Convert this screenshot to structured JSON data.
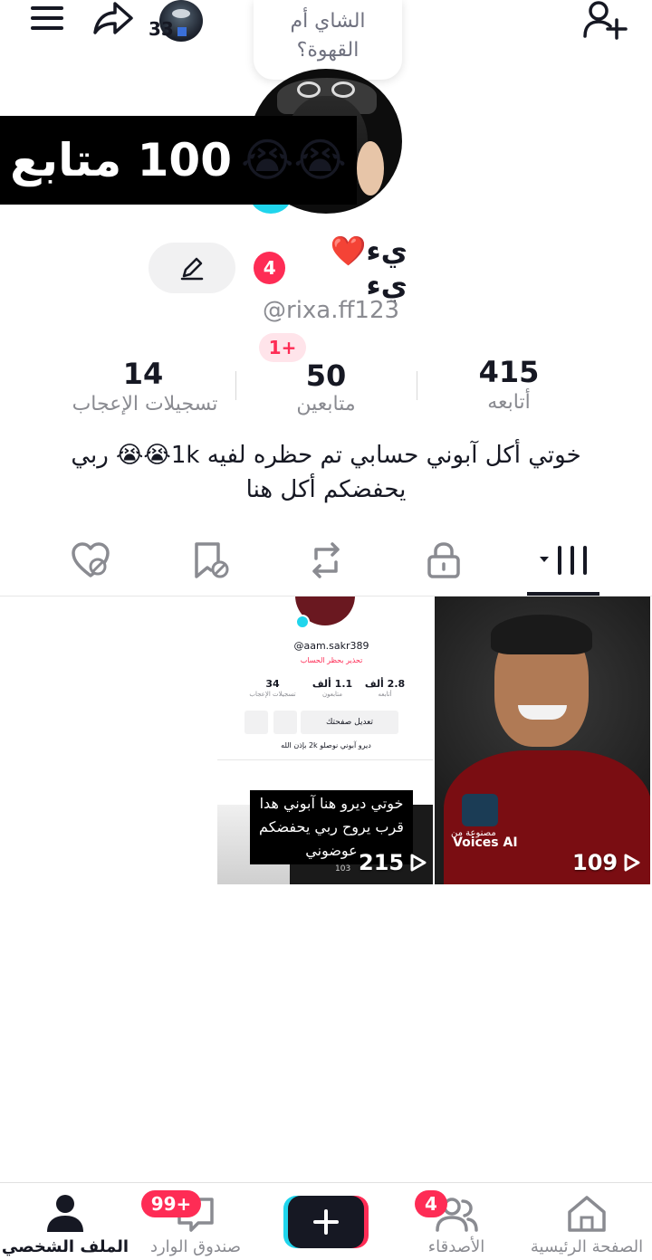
{
  "header": {
    "menu_icon": "hamburger-icon",
    "share_icon": "share-arrow-icon",
    "mini_avatar_count": "33",
    "bubble_text_line1": "الشاي أم",
    "bubble_text_line2": "القهوة؟",
    "add_friend_icon": "person-plus-icon"
  },
  "banner": {
    "text": "100 متابع",
    "emoji": "😭😭"
  },
  "profile": {
    "display_name": "يء❤️يء",
    "name_badge": "4",
    "username": "@rixa.ff123",
    "edit_icon": "pencil-icon"
  },
  "stats": {
    "new_badge": "1+",
    "following_value": "415",
    "following_label": "أتابعه",
    "followers_value": "50",
    "followers_label": "متابعين",
    "likes_value": "14",
    "likes_label": "تسجيلات الإعجاب"
  },
  "bio": {
    "line1": "خوتي أكل آبوني حسابي تم حظره لفيه 1k😭😭 ربي",
    "line2": "يحفضكم أكل هنا"
  },
  "tabs": [
    {
      "name": "videos",
      "icon": "grid-bars-icon"
    },
    {
      "name": "private",
      "icon": "lock-icon"
    },
    {
      "name": "reposts",
      "icon": "repost-icon"
    },
    {
      "name": "favorites",
      "icon": "bookmark-hidden-icon"
    },
    {
      "name": "liked",
      "icon": "heart-hidden-icon"
    }
  ],
  "videos": [
    {
      "views": "109",
      "watermark": "Voices AI",
      "watermark_small": "مصنوعة من"
    },
    {
      "views": "215",
      "caption_line1": "خوتي ديرو هنا آبوني هدا",
      "caption_line2": "قرب يروح ربي يحفضكم",
      "caption_line3": "عوضوني",
      "inner": {
        "username": "@aam.sakr389",
        "warning": "تحذير بحظر الحساب",
        "s1_val": "2.8 ألف",
        "s1_lab": "أتابعه",
        "s2_val": "1.1 ألف",
        "s2_lab": "متابعون",
        "s3_val": "34",
        "s3_lab": "تسجيلات الإعجاب",
        "edit": "تعديل صفحتك",
        "bio": "ديرو آبوني نوصلو 2k بإذن الله",
        "count": "103"
      }
    }
  ],
  "nav": {
    "home_label": "الصفحة الرئيسية",
    "friends_label": "الأصدقاء",
    "friends_badge": "4",
    "inbox_label": "صندوق الوارد",
    "inbox_badge": "99+",
    "profile_label": "الملف الشخصي"
  },
  "colors": {
    "accent": "#fe2c55",
    "cyan": "#20d5ec",
    "text": "#161823",
    "muted": "#8a8b91"
  }
}
